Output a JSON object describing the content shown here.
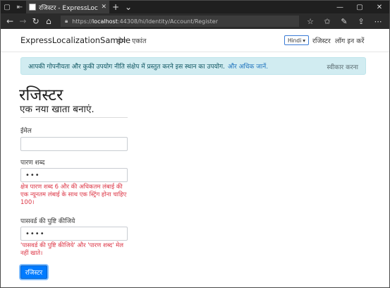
{
  "browser": {
    "tab_title": "रजिस्टर - ExpressLocalizatio",
    "address_prefix": "https://",
    "address_host": "localhost",
    "address_rest": ":44308/hi/Identity/Account/Register",
    "icons": [
      "back-icon",
      "forward-icon",
      "refresh-icon",
      "home-icon",
      "lock-icon",
      "star-icon",
      "favorites-icon",
      "pen-icon",
      "share-icon",
      "more-icon"
    ]
  },
  "site": {
    "brand": "ExpressLocalizationSample",
    "nav": {
      "home": "होम",
      "privacy": "एकांत"
    },
    "language": "Hindi",
    "register_link": "रजिस्टर",
    "login_link": "लॉग इन करें"
  },
  "cookie": {
    "text": "आपकी गोपनीयता और कुकी उपयोग नीति संक्षेप में प्रस्तुत करने इस स्थान का उपयोग.",
    "link": "और अधिक जानें.",
    "accept": "स्वीकार करना"
  },
  "form": {
    "title": "रजिस्टर",
    "subtitle": "एक नया खाता बनाएं.",
    "email_label": "ईमेल",
    "email_value": "",
    "password_label": "पारण शब्द",
    "password_value": "•••",
    "password_error": "क्षेत्र पारण शब्द 6 और की अधिकतम लंबाई की एक न्यूनतम लंबाई के साथ एक स्ट्रिंग होना चाहिए 100।",
    "confirm_label": "पासवर्ड की पुष्टि कीजिये",
    "confirm_value": "••••",
    "confirm_error": "'पासवर्ड की पुष्टि कीजिये' और 'पारण शब्द' मेल नहीं खाते।",
    "submit": "रजिस्टर"
  }
}
